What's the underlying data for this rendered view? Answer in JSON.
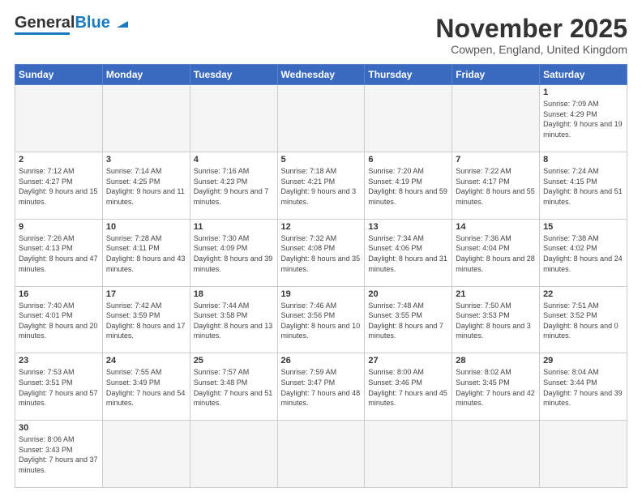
{
  "logo": {
    "text1": "General",
    "text2": "Blue"
  },
  "header": {
    "title": "November 2025",
    "subtitle": "Cowpen, England, United Kingdom"
  },
  "weekdays": [
    "Sunday",
    "Monday",
    "Tuesday",
    "Wednesday",
    "Thursday",
    "Friday",
    "Saturday"
  ],
  "weeks": [
    [
      {
        "day": "",
        "info": ""
      },
      {
        "day": "",
        "info": ""
      },
      {
        "day": "",
        "info": ""
      },
      {
        "day": "",
        "info": ""
      },
      {
        "day": "",
        "info": ""
      },
      {
        "day": "",
        "info": ""
      },
      {
        "day": "1",
        "info": "Sunrise: 7:09 AM\nSunset: 4:29 PM\nDaylight: 9 hours and 19 minutes."
      }
    ],
    [
      {
        "day": "2",
        "info": "Sunrise: 7:12 AM\nSunset: 4:27 PM\nDaylight: 9 hours and 15 minutes."
      },
      {
        "day": "3",
        "info": "Sunrise: 7:14 AM\nSunset: 4:25 PM\nDaylight: 9 hours and 11 minutes."
      },
      {
        "day": "4",
        "info": "Sunrise: 7:16 AM\nSunset: 4:23 PM\nDaylight: 9 hours and 7 minutes."
      },
      {
        "day": "5",
        "info": "Sunrise: 7:18 AM\nSunset: 4:21 PM\nDaylight: 9 hours and 3 minutes."
      },
      {
        "day": "6",
        "info": "Sunrise: 7:20 AM\nSunset: 4:19 PM\nDaylight: 8 hours and 59 minutes."
      },
      {
        "day": "7",
        "info": "Sunrise: 7:22 AM\nSunset: 4:17 PM\nDaylight: 8 hours and 55 minutes."
      },
      {
        "day": "8",
        "info": "Sunrise: 7:24 AM\nSunset: 4:15 PM\nDaylight: 8 hours and 51 minutes."
      }
    ],
    [
      {
        "day": "9",
        "info": "Sunrise: 7:26 AM\nSunset: 4:13 PM\nDaylight: 8 hours and 47 minutes."
      },
      {
        "day": "10",
        "info": "Sunrise: 7:28 AM\nSunset: 4:11 PM\nDaylight: 8 hours and 43 minutes."
      },
      {
        "day": "11",
        "info": "Sunrise: 7:30 AM\nSunset: 4:09 PM\nDaylight: 8 hours and 39 minutes."
      },
      {
        "day": "12",
        "info": "Sunrise: 7:32 AM\nSunset: 4:08 PM\nDaylight: 8 hours and 35 minutes."
      },
      {
        "day": "13",
        "info": "Sunrise: 7:34 AM\nSunset: 4:06 PM\nDaylight: 8 hours and 31 minutes."
      },
      {
        "day": "14",
        "info": "Sunrise: 7:36 AM\nSunset: 4:04 PM\nDaylight: 8 hours and 28 minutes."
      },
      {
        "day": "15",
        "info": "Sunrise: 7:38 AM\nSunset: 4:02 PM\nDaylight: 8 hours and 24 minutes."
      }
    ],
    [
      {
        "day": "16",
        "info": "Sunrise: 7:40 AM\nSunset: 4:01 PM\nDaylight: 8 hours and 20 minutes."
      },
      {
        "day": "17",
        "info": "Sunrise: 7:42 AM\nSunset: 3:59 PM\nDaylight: 8 hours and 17 minutes."
      },
      {
        "day": "18",
        "info": "Sunrise: 7:44 AM\nSunset: 3:58 PM\nDaylight: 8 hours and 13 minutes."
      },
      {
        "day": "19",
        "info": "Sunrise: 7:46 AM\nSunset: 3:56 PM\nDaylight: 8 hours and 10 minutes."
      },
      {
        "day": "20",
        "info": "Sunrise: 7:48 AM\nSunset: 3:55 PM\nDaylight: 8 hours and 7 minutes."
      },
      {
        "day": "21",
        "info": "Sunrise: 7:50 AM\nSunset: 3:53 PM\nDaylight: 8 hours and 3 minutes."
      },
      {
        "day": "22",
        "info": "Sunrise: 7:51 AM\nSunset: 3:52 PM\nDaylight: 8 hours and 0 minutes."
      }
    ],
    [
      {
        "day": "23",
        "info": "Sunrise: 7:53 AM\nSunset: 3:51 PM\nDaylight: 7 hours and 57 minutes."
      },
      {
        "day": "24",
        "info": "Sunrise: 7:55 AM\nSunset: 3:49 PM\nDaylight: 7 hours and 54 minutes."
      },
      {
        "day": "25",
        "info": "Sunrise: 7:57 AM\nSunset: 3:48 PM\nDaylight: 7 hours and 51 minutes."
      },
      {
        "day": "26",
        "info": "Sunrise: 7:59 AM\nSunset: 3:47 PM\nDaylight: 7 hours and 48 minutes."
      },
      {
        "day": "27",
        "info": "Sunrise: 8:00 AM\nSunset: 3:46 PM\nDaylight: 7 hours and 45 minutes."
      },
      {
        "day": "28",
        "info": "Sunrise: 8:02 AM\nSunset: 3:45 PM\nDaylight: 7 hours and 42 minutes."
      },
      {
        "day": "29",
        "info": "Sunrise: 8:04 AM\nSunset: 3:44 PM\nDaylight: 7 hours and 39 minutes."
      }
    ],
    [
      {
        "day": "30",
        "info": "Sunrise: 8:06 AM\nSunset: 3:43 PM\nDaylight: 7 hours and 37 minutes."
      },
      {
        "day": "",
        "info": ""
      },
      {
        "day": "",
        "info": ""
      },
      {
        "day": "",
        "info": ""
      },
      {
        "day": "",
        "info": ""
      },
      {
        "day": "",
        "info": ""
      },
      {
        "day": "",
        "info": ""
      }
    ]
  ]
}
